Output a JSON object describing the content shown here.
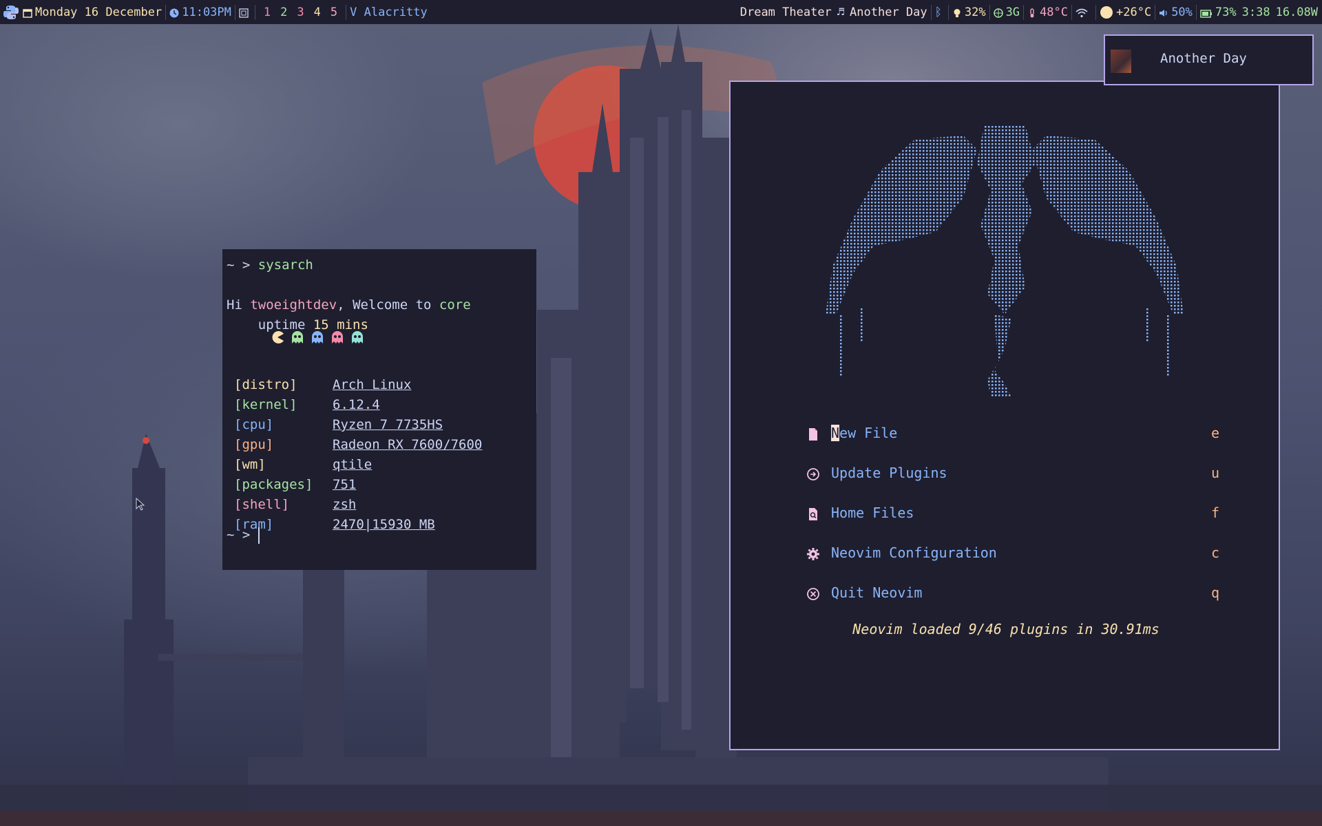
{
  "colors": {
    "bar_bg": "#1e1e2e",
    "text": "#cdd6f4",
    "accent_border": "#b4a4e8",
    "blue": "#89b4fa",
    "green": "#a6e3a1",
    "yellow": "#f9e2af",
    "peach": "#fab387",
    "pink": "#f5a4c0",
    "red": "#f38ba8",
    "teal": "#94e2d5"
  },
  "topbar": {
    "logo_icon": "python-icon",
    "date": "Monday 16 December",
    "time": "11:03PM",
    "layout_icon": "layout-max-icon",
    "workspaces": [
      {
        "label": "1",
        "color": "#f38ba8"
      },
      {
        "label": "2",
        "color": "#a6e3a1"
      },
      {
        "label": "3",
        "color": "#f38ba8"
      },
      {
        "label": "4",
        "color": "#f9e2af"
      },
      {
        "label": "5",
        "color": "#f5a4c0"
      }
    ],
    "window_title": "V Alacritty",
    "music_artist": "Dream Theater",
    "music_track": "Another Day",
    "brightness": "32%",
    "network": "3G",
    "temperature": "48°C",
    "weather": "+26°C",
    "volume": "50%",
    "battery": "73%",
    "battery_time": "3:38",
    "power": "16.08W"
  },
  "terminal": {
    "prompt": "~ >",
    "command": "sysarch",
    "greeting_hi": "Hi",
    "username": "twoeightdev",
    "greeting_welcome": ", Welcome to",
    "host": "core",
    "uptime_label": "uptime",
    "uptime_value": "15 mins",
    "info": [
      {
        "key": "[distro]",
        "value": "Arch Linux",
        "color": "#f9e2af"
      },
      {
        "key": "[kernel]",
        "value": "6.12.4",
        "color": "#a6e3a1"
      },
      {
        "key": "[cpu]",
        "value": "Ryzen 7 7735HS",
        "color": "#89b4fa"
      },
      {
        "key": "[gpu]",
        "value": "Radeon RX 7600/7600",
        "color": "#fab387"
      },
      {
        "key": "[wm]",
        "value": "qtile",
        "color": "#f9e2af"
      },
      {
        "key": "[packages]",
        "value": "751",
        "color": "#a6e3a1"
      },
      {
        "key": "[shell]",
        "value": "zsh",
        "color": "#f5a4c0"
      },
      {
        "key": "[ram]",
        "value": "2470|15930 MB",
        "color": "#89b4fa"
      }
    ],
    "prompt2": "~ >"
  },
  "nvim": {
    "items": [
      {
        "icon": "file-icon",
        "label": "New File",
        "key": "e"
      },
      {
        "icon": "update-icon",
        "label": "Update Plugins",
        "key": "u"
      },
      {
        "icon": "search-file-icon",
        "label": "Home Files",
        "key": "f"
      },
      {
        "icon": "gear-icon",
        "label": "Neovim Configuration",
        "key": "c"
      },
      {
        "icon": "close-circle-icon",
        "label": "Quit Neovim",
        "key": "q"
      }
    ],
    "footer": "Neovim loaded 9/46 plugins in 30.91ms"
  },
  "notification": {
    "title": "Another Day"
  }
}
